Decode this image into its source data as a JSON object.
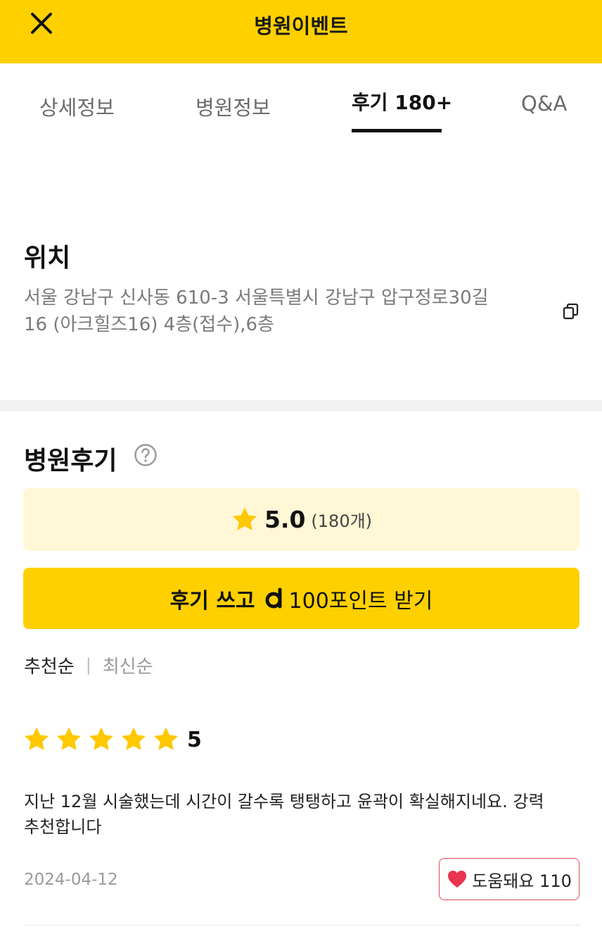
{
  "header": {
    "title": "병원이벤트",
    "close_icon": "close-icon"
  },
  "tabs": [
    {
      "label": "상세정보",
      "active": false
    },
    {
      "label": "병원정보",
      "active": false
    },
    {
      "label": "후기 180+",
      "active": true
    },
    {
      "label": "Q&A",
      "active": false
    }
  ],
  "location": {
    "title": "위치",
    "address_line1": "서울 강남구 신사동 610-3 서울특별시 강남구 압구정로30길",
    "address_line2": "16 (아크힐즈16) 4층(접수),6층",
    "copy_icon": "copy-icon"
  },
  "reviews_section": {
    "title": "병원후기",
    "help_icon": "question-circle-icon",
    "rating": {
      "value": "5.0",
      "count": "(180개)",
      "icon": "star-icon"
    },
    "write_button": {
      "prefix": "후기 쓰고",
      "suffix": "100포인트 받기",
      "logo_icon": "point-logo-icon"
    },
    "sort": {
      "active": "추천순",
      "separator": "|",
      "inactive": "최신순"
    }
  },
  "review": {
    "stars": 5,
    "score": "5",
    "text_line1": "지난 12월 시술했는데 시간이 갈수록 탱탱하고 윤곽이 확실해지네요. 강력",
    "text_line2": "추천합니다",
    "date": "2024-04-12",
    "helpful_label": "도움돼요 110",
    "helpful_icon": "heart-icon"
  },
  "colors": {
    "brand_yellow": "#FED000",
    "rating_bg": "#FFF7D6",
    "star": "#FFC800",
    "heart": "#E8344E"
  }
}
